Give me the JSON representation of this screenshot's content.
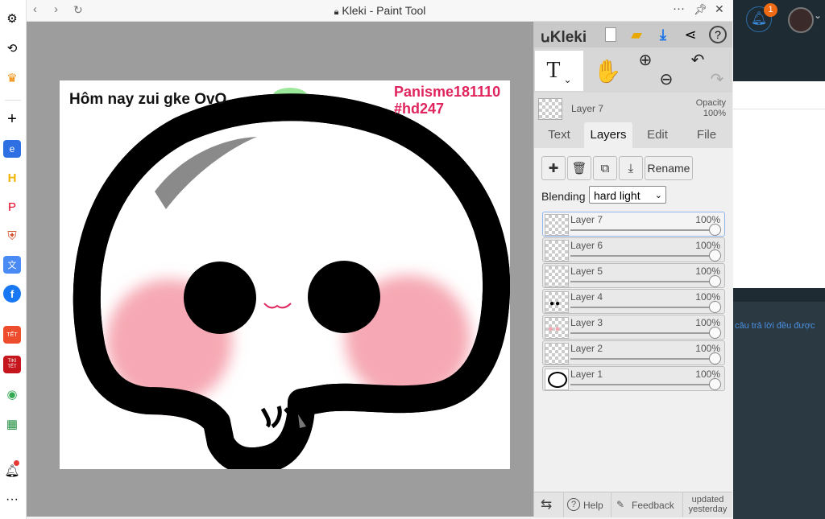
{
  "window": {
    "title": "Kleki - Paint Tool"
  },
  "browser_sidebar": {
    "icons": [
      "gear-icon",
      "history-icon",
      "crown-icon",
      "plus-icon",
      "edge-app-icon",
      "h-app-icon",
      "pinterest-icon",
      "shield-app-icon",
      "translate-icon",
      "facebook-icon",
      "shopee-tet-icon",
      "tiki-tet-icon",
      "maps-app-icon",
      "sheets-app-icon",
      "bell-icon",
      "more-icon"
    ],
    "badge_shopee": "TẾT",
    "badge_tiki": "TIKI TẾT"
  },
  "canvas": {
    "text_left": "Hôm nay zui gke OvO",
    "text_right_1": "Panisme181110",
    "text_right_2": "#hd247",
    "colors": {
      "accent_text": "#e0245e",
      "blush": "#f6a9b4",
      "leaf": "#9be89a"
    }
  },
  "kleki": {
    "logo": "Kleki",
    "top_icons": [
      "new-file-icon",
      "open-folder-icon",
      "download-icon",
      "share-icon",
      "help-icon"
    ],
    "help_glyph": "?",
    "tools": {
      "text": "T",
      "dropdown": "⌄",
      "hand": "✋",
      "zoom_in": "⊕",
      "zoom_out": "⊖",
      "undo": "↶",
      "redo": "↷"
    },
    "current_layer": "Layer 7",
    "opacity_label": "Opacity",
    "opacity_value": "100%",
    "tabs": [
      {
        "label": "Text"
      },
      {
        "label": "Layers",
        "active": true
      },
      {
        "label": "Edit"
      },
      {
        "label": "File"
      }
    ],
    "layer_buttons": {
      "add": "✚",
      "delete": "🗑",
      "duplicate": "⧉",
      "merge": "⤓",
      "rename": "Rename"
    },
    "blending_label": "Blending",
    "blending_value": "hard light",
    "layers": [
      {
        "name": "Layer 7",
        "opacity": "100%",
        "selected": true
      },
      {
        "name": "Layer 6",
        "opacity": "100%"
      },
      {
        "name": "Layer 5",
        "opacity": "100%"
      },
      {
        "name": "Layer 4",
        "opacity": "100%"
      },
      {
        "name": "Layer 3",
        "opacity": "100%"
      },
      {
        "name": "Layer 2",
        "opacity": "100%"
      },
      {
        "name": "Layer 1",
        "opacity": "100%"
      }
    ],
    "bottom": {
      "swap": "⇆",
      "help": "Help",
      "feedback": "Feedback",
      "updated_1": "updated",
      "updated_2": "yesterday"
    }
  },
  "right_page": {
    "notif_count": "1",
    "snippet": "câu trả lời đều được"
  }
}
